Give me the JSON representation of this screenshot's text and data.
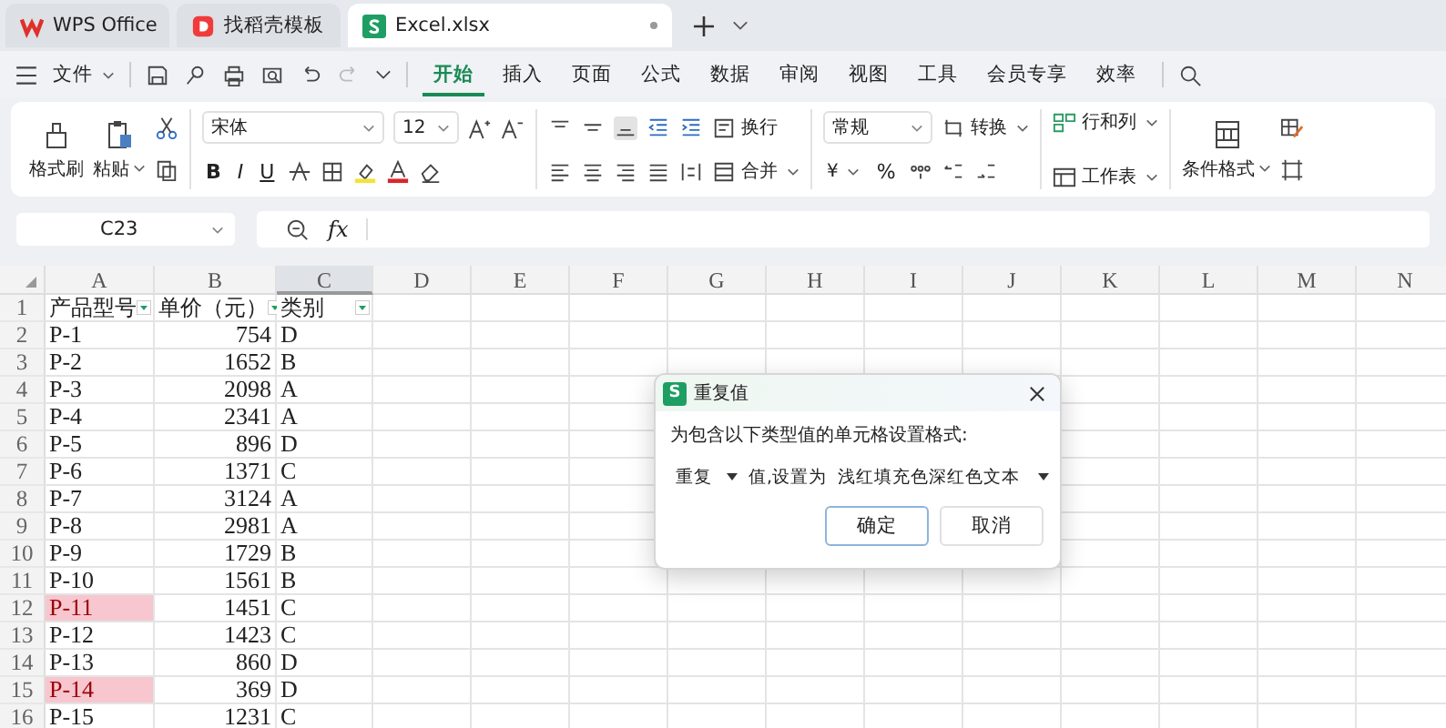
{
  "window_tabs": [
    {
      "label": "WPS Office",
      "kind": "wps",
      "selected": false
    },
    {
      "label": "找稻壳模板",
      "kind": "docer",
      "selected": false
    },
    {
      "label": "Excel.xlsx",
      "kind": "sheet",
      "selected": true
    }
  ],
  "file_menu": "文件",
  "ribbon_tabs": [
    {
      "label": "开始",
      "selected": true
    },
    {
      "label": "插入",
      "selected": false
    },
    {
      "label": "页面",
      "selected": false
    },
    {
      "label": "公式",
      "selected": false
    },
    {
      "label": "数据",
      "selected": false
    },
    {
      "label": "审阅",
      "selected": false
    },
    {
      "label": "视图",
      "selected": false
    },
    {
      "label": "工具",
      "selected": false
    },
    {
      "label": "会员专享",
      "selected": false
    },
    {
      "label": "效率",
      "selected": false
    }
  ],
  "ribbon": {
    "format_painter": "格式刷",
    "paste": "粘贴",
    "font_name": "宋体",
    "font_size": "12",
    "bold": "B",
    "italic": "I",
    "underline": "U",
    "wrap": "换行",
    "merge": "合并",
    "number_format": "常规",
    "convert": "转换",
    "currency": "¥",
    "percent": "%",
    "rows_cols": "行和列",
    "worksheet": "工作表",
    "conditional_format": "条件格式"
  },
  "name_box": "C23",
  "fx": "fx",
  "sheet": {
    "columns": [
      {
        "label": "A",
        "selected": false
      },
      {
        "label": "B",
        "selected": false
      },
      {
        "label": "C",
        "selected": true
      },
      {
        "label": "D",
        "selected": false
      },
      {
        "label": "E",
        "selected": false
      },
      {
        "label": "F",
        "selected": false
      },
      {
        "label": "G",
        "selected": false
      },
      {
        "label": "H",
        "selected": false
      },
      {
        "label": "I",
        "selected": false
      },
      {
        "label": "J",
        "selected": false
      },
      {
        "label": "K",
        "selected": false
      },
      {
        "label": "L",
        "selected": false
      },
      {
        "label": "M",
        "selected": false
      },
      {
        "label": "N",
        "selected": false
      }
    ],
    "header_row": {
      "num": "1",
      "cells": [
        "产品型号",
        "单价（元）",
        "类别"
      ]
    },
    "rows": [
      {
        "num": "2",
        "cells": [
          "P-1",
          "754",
          "D"
        ],
        "highlighted": false
      },
      {
        "num": "3",
        "cells": [
          "P-2",
          "1652",
          "B"
        ],
        "highlighted": false
      },
      {
        "num": "4",
        "cells": [
          "P-3",
          "2098",
          "A"
        ],
        "highlighted": false
      },
      {
        "num": "5",
        "cells": [
          "P-4",
          "2341",
          "A"
        ],
        "highlighted": false
      },
      {
        "num": "6",
        "cells": [
          "P-5",
          "896",
          "D"
        ],
        "highlighted": false
      },
      {
        "num": "7",
        "cells": [
          "P-6",
          "1371",
          "C"
        ],
        "highlighted": false
      },
      {
        "num": "8",
        "cells": [
          "P-7",
          "3124",
          "A"
        ],
        "highlighted": false
      },
      {
        "num": "9",
        "cells": [
          "P-8",
          "2981",
          "A"
        ],
        "highlighted": false
      },
      {
        "num": "10",
        "cells": [
          "P-9",
          "1729",
          "B"
        ],
        "highlighted": false
      },
      {
        "num": "11",
        "cells": [
          "P-10",
          "1561",
          "B"
        ],
        "highlighted": false
      },
      {
        "num": "12",
        "cells": [
          "P-11",
          "1451",
          "C"
        ],
        "highlighted": true
      },
      {
        "num": "13",
        "cells": [
          "P-12",
          "1423",
          "C"
        ],
        "highlighted": false
      },
      {
        "num": "14",
        "cells": [
          "P-13",
          "860",
          "D"
        ],
        "highlighted": false
      },
      {
        "num": "15",
        "cells": [
          "P-14",
          "369",
          "D"
        ],
        "highlighted": true
      },
      {
        "num": "16",
        "cells": [
          "P-15",
          "1231",
          "C"
        ],
        "highlighted": false
      }
    ]
  },
  "dialog": {
    "app_badge": "S",
    "title": "重复值",
    "prompt": "为包含以下类型值的单元格设置格式:",
    "rule_select": "重复",
    "between": "值,设置为",
    "format_select": "浅红填充色深红色文本",
    "buttons": [
      {
        "label": "确定",
        "primary": true
      },
      {
        "label": "取消",
        "primary": false
      }
    ]
  }
}
